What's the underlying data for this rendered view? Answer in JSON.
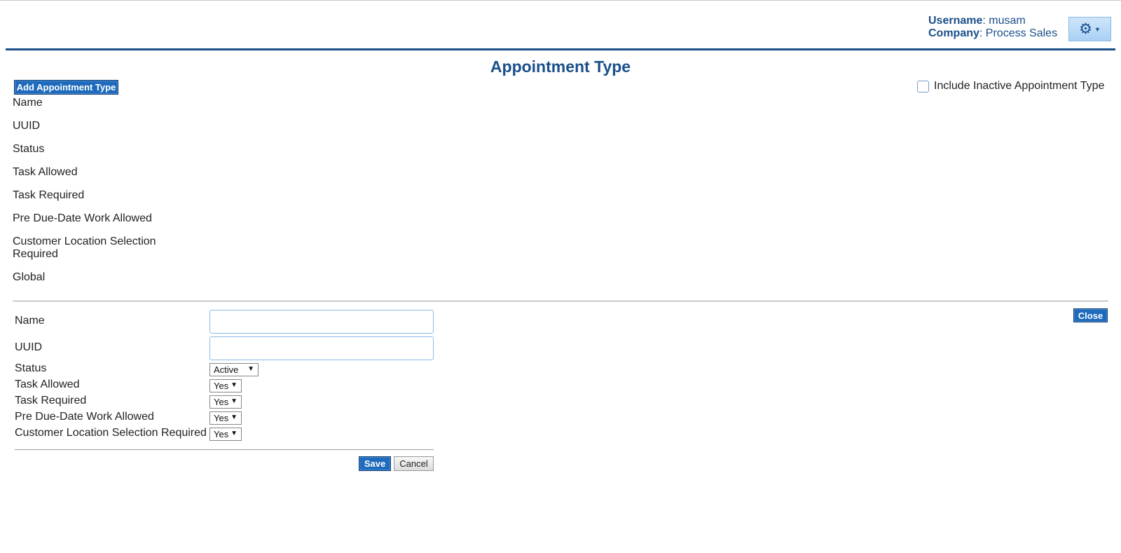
{
  "header": {
    "username_label": "Username",
    "username_value": ": musam",
    "company_label": "Company",
    "company_value": ": Process Sales"
  },
  "page": {
    "title": "Appointment Type",
    "add_button": "Add Appointment Type",
    "include_inactive_label": "Include Inactive Appointment Type",
    "include_inactive_checked": false
  },
  "columns": [
    "Name",
    "UUID",
    "Status",
    "Task Allowed",
    "Task Required",
    "Pre Due-Date Work Allowed",
    "Customer Location Selection Required",
    "Global"
  ],
  "form": {
    "close_button": "Close",
    "name_label": "Name",
    "name_value": "",
    "uuid_label": "UUID",
    "uuid_value": "",
    "status_label": "Status",
    "status_value": "Active",
    "task_allowed_label": "Task Allowed",
    "task_allowed_value": "Yes",
    "task_required_label": "Task Required",
    "task_required_value": "Yes",
    "pre_due_label": "Pre Due-Date Work Allowed",
    "pre_due_value": "Yes",
    "customer_location_label": "Customer Location Selection Required",
    "customer_location_value": "Yes",
    "save_button": "Save",
    "cancel_button": "Cancel"
  },
  "colors": {
    "brand_blue": "#1a4f8a",
    "button_blue": "#1e6bbd"
  },
  "icons": {
    "settings": "gear-icon",
    "dropdown": "caret-down-icon"
  }
}
